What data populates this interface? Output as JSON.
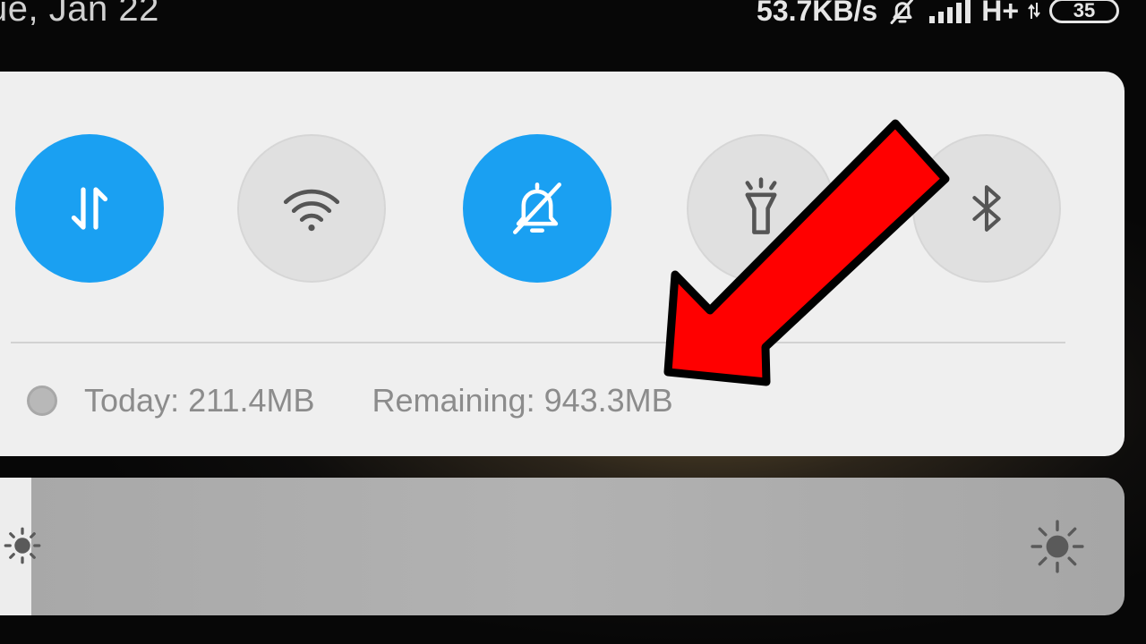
{
  "status_bar": {
    "date": "ue, Jan 22",
    "net_speed": "53.7KB/s",
    "net_type": "H+",
    "battery": "35",
    "icons": [
      "bell-off-icon",
      "signal-icon",
      "data-activity-icon",
      "battery-icon"
    ]
  },
  "quick_settings": {
    "toggles": [
      {
        "name": "Mobile data",
        "icon": "data-transfer-icon",
        "state": "on"
      },
      {
        "name": "Wi-Fi",
        "icon": "wifi-icon",
        "state": "off"
      },
      {
        "name": "Silent",
        "icon": "bell-off-icon",
        "state": "on"
      },
      {
        "name": "Flashlight",
        "icon": "flashlight-icon",
        "state": "off"
      },
      {
        "name": "Bluetooth",
        "icon": "bluetooth-icon",
        "state": "off"
      }
    ],
    "usage": {
      "today": "Today: 211.4MB",
      "remaining": "Remaining: 943.3MB"
    }
  },
  "brightness": {
    "level": 0.058,
    "low_icon": "sun-low-icon",
    "high_icon": "sun-high-icon"
  },
  "annotation": {
    "icon": "red-arrow-icon",
    "color": "#ff0000"
  },
  "colors": {
    "toggle_on": "#1aa0f2",
    "toggle_off": "#e0e0e0",
    "panel": "#efefef"
  }
}
